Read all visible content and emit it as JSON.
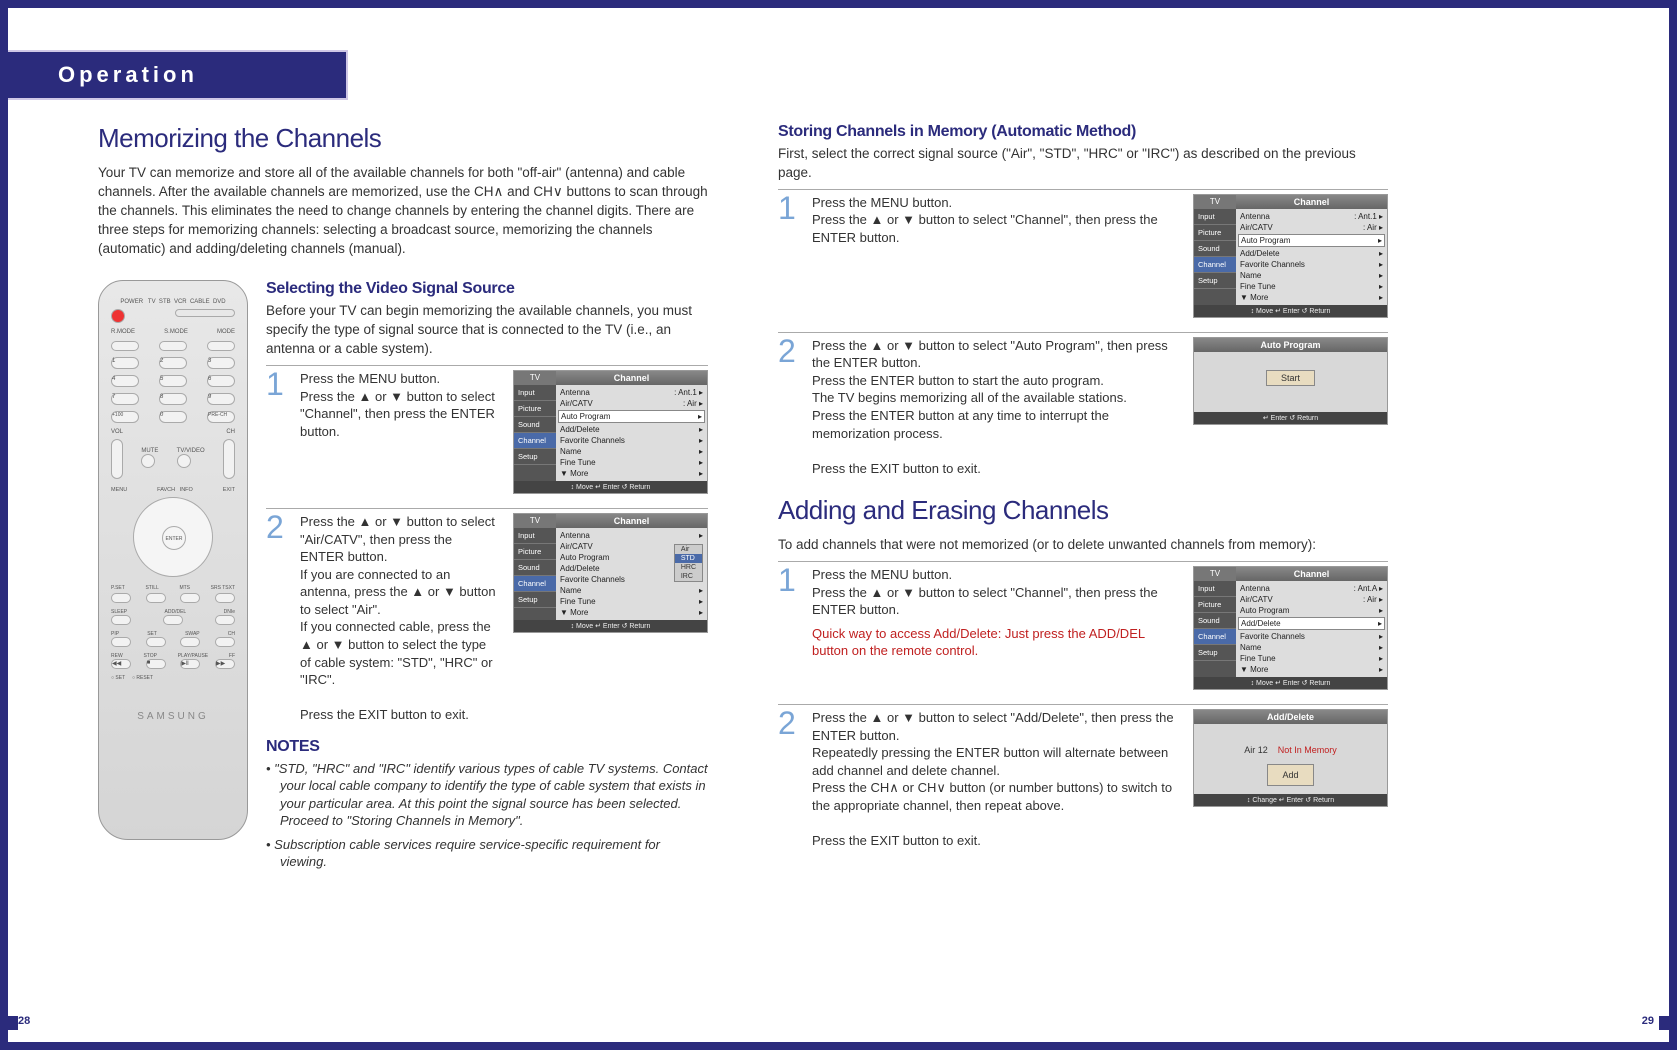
{
  "section_tab": "Operation",
  "page_left": "28",
  "page_right": "29",
  "left": {
    "h1": "Memorizing the Channels",
    "intro": "Your TV can memorize and store all of the available channels for both \"off-air\" (antenna) and cable channels. After the available channels are memorized, use the CH∧ and CH∨ buttons to scan through the channels. This eliminates the need to change channels by entering the channel digits. There are three steps for memorizing channels: selecting a broadcast source, memorizing the channels (automatic) and adding/deleting channels (manual).",
    "h2": "Selecting the Video Signal Source",
    "intro2": "Before your TV can begin memorizing the available channels, you must specify the type of signal source that is connected to the TV (i.e., an antenna or a cable system).",
    "step1": "Press the MENU button.\nPress the ▲ or ▼ button to select \"Channel\", then press the ENTER button.",
    "step2": "Press the ▲ or ▼ button to select \"Air/CATV\", then press the ENTER button.\nIf you are connected to an antenna, press the ▲ or ▼ button to select \"Air\".\nIf you connected cable, press the ▲ or ▼ button to select the type of cable system: \"STD\", \"HRC\" or \"IRC\".\n\nPress the EXIT button to exit.",
    "notes_h": "NOTES",
    "note1": "\"STD, \"HRC\" and \"IRC\" identify various types of cable TV systems. Contact your local cable company to identify the type of cable system that exists in your particular area. At this point the signal source has been selected. Proceed to \"Storing Channels in Memory\".",
    "note2": "Subscription cable services require service-specific requirement for viewing.",
    "remote_brand": "SAMSUNG",
    "menu1": {
      "title": "Channel",
      "tv": "TV",
      "side": [
        "Input",
        "Picture",
        "Sound",
        "Channel",
        "Setup"
      ],
      "items": [
        [
          "Antenna",
          ": Ant.1"
        ],
        [
          "Air/CATV",
          ": Air"
        ],
        [
          "Auto Program",
          ""
        ],
        [
          "Add/Delete",
          ""
        ],
        [
          "Favorite Channels",
          ""
        ],
        [
          "Name",
          ""
        ],
        [
          "Fine Tune",
          ""
        ],
        [
          "▼ More",
          ""
        ]
      ],
      "highlight_index": 2,
      "foot": "↕ Move    ↵ Enter    ↺ Return"
    },
    "menu2": {
      "title": "Channel",
      "tv": "TV",
      "side": [
        "Input",
        "Picture",
        "Sound",
        "Channel",
        "Setup"
      ],
      "items": [
        [
          "Antenna",
          ""
        ],
        [
          "Air/CATV",
          ""
        ],
        [
          "Auto Program",
          ""
        ],
        [
          "Add/Delete",
          ""
        ],
        [
          "Favorite Channels",
          ""
        ],
        [
          "Name",
          ""
        ],
        [
          "Fine Tune",
          ""
        ],
        [
          "▼ More",
          ""
        ]
      ],
      "opts": [
        "Air",
        "STD",
        "HRC",
        "IRC"
      ],
      "opts_sel": 1,
      "foot": "↕ Move    ↵ Enter    ↺ Return"
    }
  },
  "right": {
    "h1": "Storing Channels in Memory (Automatic Method)",
    "intro": "First, select the correct signal source (\"Air\", \"STD\", \"HRC\" or \"IRC\") as described on the previous page.",
    "step1": "Press the MENU button.\nPress the ▲ or ▼ button to select \"Channel\", then press the ENTER button.",
    "step2": "Press the ▲ or ▼ button to select \"Auto Program\", then press the ENTER button.\nPress the ENTER button to start the auto program.\nThe TV begins memorizing all of the available stations.\nPress the ENTER button at any time to interrupt the memorization process.\n\nPress the EXIT button to exit.",
    "menu1": {
      "title": "Channel",
      "tv": "TV",
      "side": [
        "Input",
        "Picture",
        "Sound",
        "Channel",
        "Setup"
      ],
      "items": [
        [
          "Antenna",
          ": Ant.1"
        ],
        [
          "Air/CATV",
          ": Air"
        ],
        [
          "Auto Program",
          ""
        ],
        [
          "Add/Delete",
          ""
        ],
        [
          "Favorite Channels",
          ""
        ],
        [
          "Name",
          ""
        ],
        [
          "Fine Tune",
          ""
        ],
        [
          "▼ More",
          ""
        ]
      ],
      "highlight_index": 2,
      "foot": "↕ Move    ↵ Enter    ↺ Return"
    },
    "menu2": {
      "title": "Auto Program",
      "start": "Start",
      "foot": "↵ Enter        ↺ Return"
    },
    "h2": "Adding and Erasing Channels",
    "intro2": "To add channels that were not memorized (or to delete unwanted channels from memory):",
    "step3": "Press the MENU button.\nPress the ▲ or ▼ button to select \"Channel\", then press the ENTER button.",
    "step3_red": "Quick way to access Add/Delete: Just press the ADD/DEL button on the remote control.",
    "step4": "Press the ▲ or ▼ button to select \"Add/Delete\", then press the ENTER button.\nRepeatedly pressing the ENTER button will alternate between add channel and delete channel.\nPress the CH∧ or CH∨ button (or number buttons) to switch to the appropriate channel, then repeat above.\n\nPress the EXIT button to exit.",
    "menu3": {
      "title": "Channel",
      "tv": "TV",
      "side": [
        "Input",
        "Picture",
        "Sound",
        "Channel",
        "Setup"
      ],
      "items": [
        [
          "Antenna",
          ": Ant.A"
        ],
        [
          "Air/CATV",
          ": Air"
        ],
        [
          "Auto Program",
          ""
        ],
        [
          "Add/Delete",
          ""
        ],
        [
          "Favorite Channels",
          ""
        ],
        [
          "Name",
          ""
        ],
        [
          "Fine Tune",
          ""
        ],
        [
          "▼ More",
          ""
        ]
      ],
      "highlight_index": 3,
      "foot": "↕ Move    ↵ Enter    ↺ Return"
    },
    "menu4": {
      "title": "Add/Delete",
      "ch": "Air 12",
      "status": "Not In Memory",
      "btn": "Add",
      "foot": "↕ Change    ↵ Enter        ↺ Return"
    }
  }
}
